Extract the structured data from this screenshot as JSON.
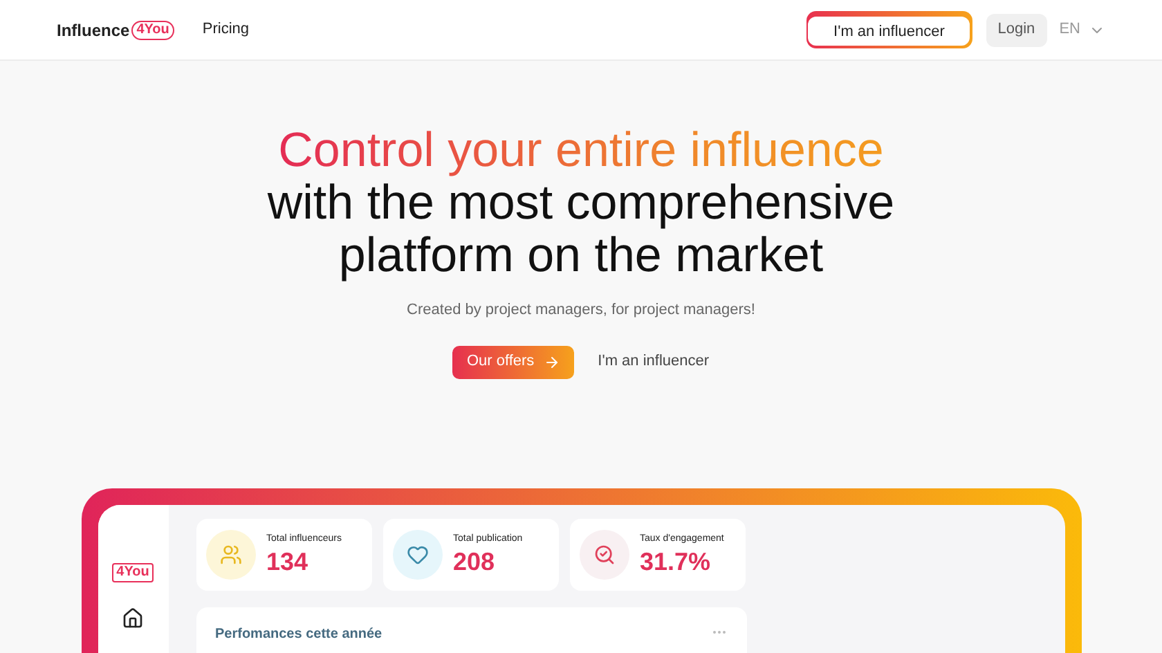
{
  "header": {
    "logo": {
      "name": "Influence",
      "badge": "4You"
    },
    "nav": [
      "Pricing"
    ],
    "influencer_button": "I'm an influencer",
    "login_button": "Login",
    "language": "EN"
  },
  "hero": {
    "title_accent": "Control your entire influence",
    "title": "with the most comprehensive platform on the market",
    "subtitle": "Created by project managers, for project managers!",
    "primary_button": "Our offers",
    "secondary_button": "I'm an influencer"
  },
  "dashboard": {
    "logo": "4You",
    "stats": [
      {
        "kind": "people",
        "label": "Total influenceurs",
        "value": "134",
        "color": "#fdf6d8"
      },
      {
        "kind": "heart",
        "label": "Total publication",
        "value": "208",
        "color": "#e6f6fb"
      },
      {
        "kind": "chart",
        "label": "Taux d'engagement",
        "value": "31.7%",
        "color": "#f8f0f2"
      }
    ],
    "section_title": "Perfomances cette année"
  }
}
